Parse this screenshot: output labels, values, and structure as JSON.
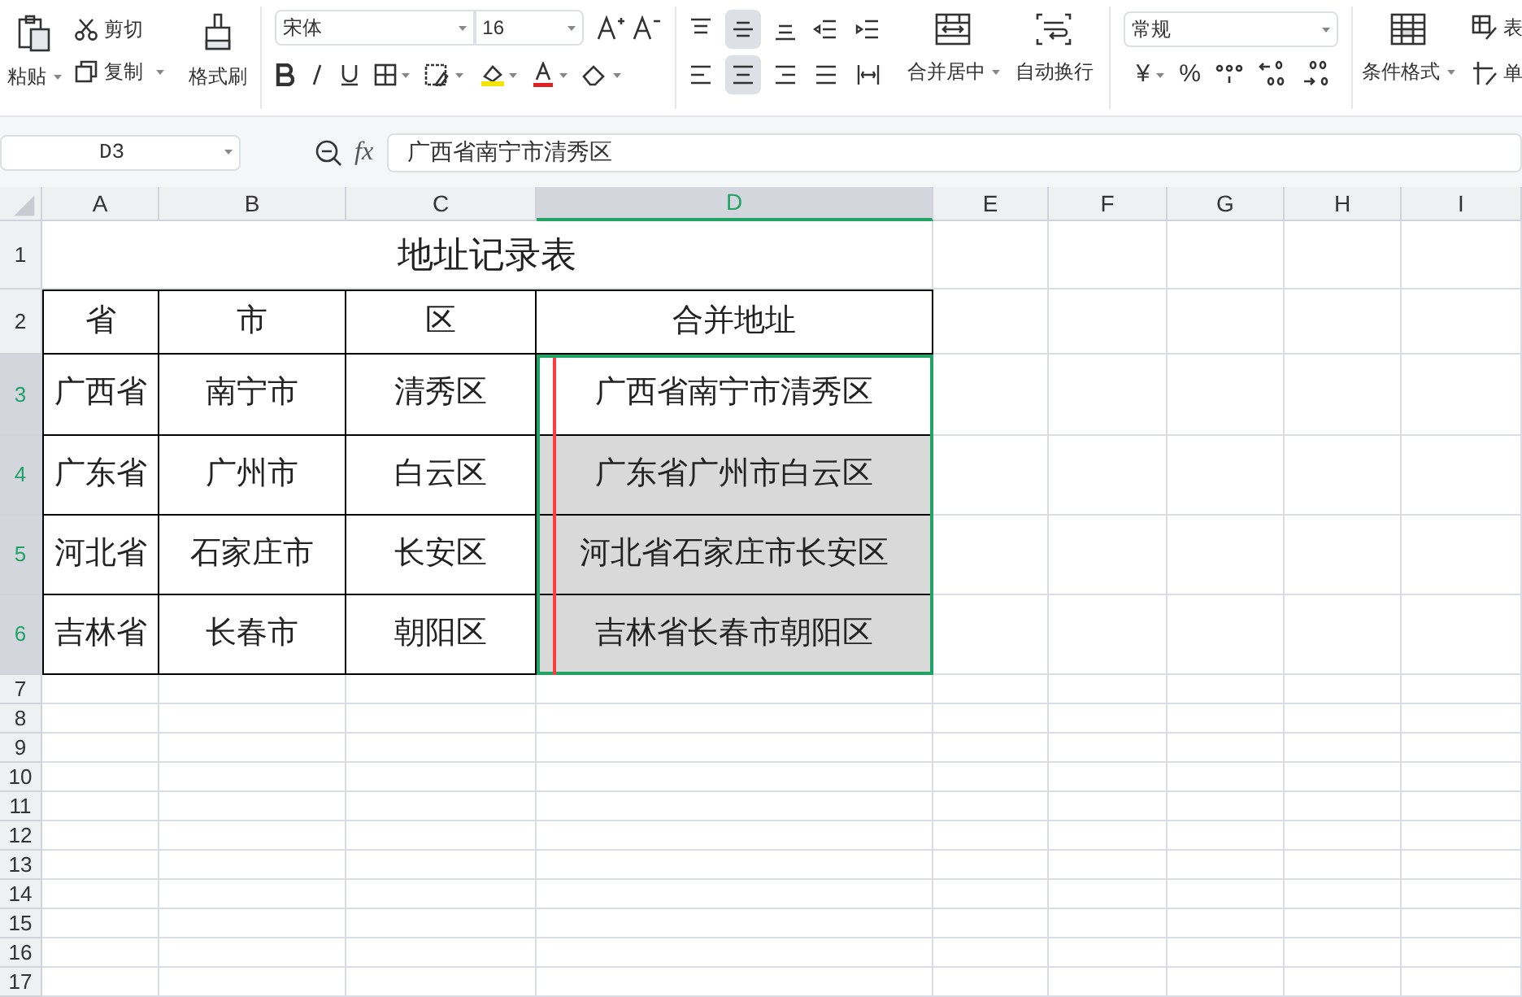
{
  "toolbar": {
    "paste": "粘贴",
    "cut": "剪切",
    "copy": "复制",
    "format_painter": "格式刷",
    "font": "宋体",
    "font_size": "16",
    "merge_center": "合并居中",
    "wrap_text": "自动换行",
    "number_format": "常规",
    "currency": "¥",
    "percent": "%",
    "conditional_format": "条件格式",
    "table_style": "表",
    "cell_style": "单",
    "align_buttons": [
      {
        "selected": false
      },
      {
        "selected": true
      },
      {
        "selected": false
      },
      {
        "selected": false
      },
      {
        "selected": false
      },
      {
        "selected": false
      },
      {
        "selected": true
      },
      {
        "selected": false
      },
      {
        "selected": false
      },
      {
        "selected": false
      }
    ]
  },
  "formula_bar": {
    "name_box": "D3",
    "fx": "fx",
    "formula": "广西省南宁市清秀区"
  },
  "columns": [
    {
      "label": "A",
      "selected": false
    },
    {
      "label": "B",
      "selected": false
    },
    {
      "label": "C",
      "selected": false
    },
    {
      "label": "D",
      "selected": true
    },
    {
      "label": "E",
      "selected": false
    },
    {
      "label": "F",
      "selected": false
    },
    {
      "label": "G",
      "selected": false
    },
    {
      "label": "H",
      "selected": false
    },
    {
      "label": "I",
      "selected": false
    }
  ],
  "rows": [
    {
      "label": "1",
      "selected": false
    },
    {
      "label": "2",
      "selected": false
    },
    {
      "label": "3",
      "selected": true
    },
    {
      "label": "4",
      "selected": true
    },
    {
      "label": "5",
      "selected": true
    },
    {
      "label": "6",
      "selected": true
    },
    {
      "label": "7",
      "selected": false
    },
    {
      "label": "8",
      "selected": false
    },
    {
      "label": "9",
      "selected": false
    },
    {
      "label": "10",
      "selected": false
    },
    {
      "label": "11",
      "selected": false
    },
    {
      "label": "12",
      "selected": false
    },
    {
      "label": "13",
      "selected": false
    },
    {
      "label": "14",
      "selected": false
    },
    {
      "label": "15",
      "selected": false
    },
    {
      "label": "16",
      "selected": false
    },
    {
      "label": "17",
      "selected": false
    }
  ],
  "table": {
    "title": "地址记录表",
    "headers": [
      "省",
      "市",
      "区",
      "合并地址"
    ],
    "data": [
      {
        "cells": [
          {
            "text": "广西省",
            "selected": false
          },
          {
            "text": "南宁市",
            "selected": false
          },
          {
            "text": "清秀区",
            "selected": false
          },
          {
            "text": "广西省南宁市清秀区",
            "selected": true,
            "active": true
          }
        ]
      },
      {
        "cells": [
          {
            "text": "广东省",
            "selected": false
          },
          {
            "text": "广州市",
            "selected": false
          },
          {
            "text": "白云区",
            "selected": false
          },
          {
            "text": "广东省广州市白云区",
            "selected": true,
            "active": false
          }
        ]
      },
      {
        "cells": [
          {
            "text": "河北省",
            "selected": false
          },
          {
            "text": "石家庄市",
            "selected": false
          },
          {
            "text": "长安区",
            "selected": false
          },
          {
            "text": "河北省石家庄市长安区",
            "selected": true,
            "active": false
          }
        ]
      },
      {
        "cells": [
          {
            "text": "吉林省",
            "selected": false
          },
          {
            "text": "长春市",
            "selected": false
          },
          {
            "text": "朝阳区",
            "selected": false
          },
          {
            "text": "吉林省长春市朝阳区",
            "selected": true,
            "active": false
          }
        ]
      }
    ]
  }
}
